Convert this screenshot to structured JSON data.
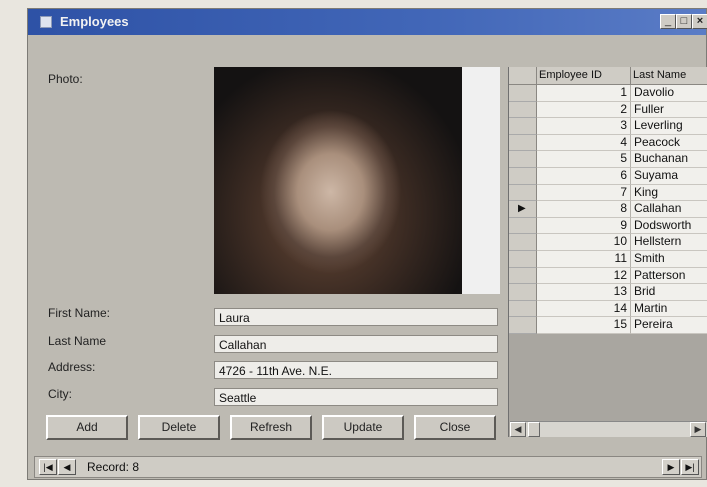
{
  "window": {
    "title": "Employees"
  },
  "labels": {
    "photo": "Photo:",
    "first_name": "First Name:",
    "last_name": "Last Name",
    "address": "Address:",
    "city": "City:"
  },
  "fields": {
    "first_name": "Laura",
    "last_name": "Callahan",
    "address": "4726 - 11th Ave. N.E.",
    "city": "Seattle"
  },
  "buttons": {
    "add": "Add",
    "delete": "Delete",
    "refresh": "Refresh",
    "update": "Update",
    "close": "Close"
  },
  "grid": {
    "columns": [
      "Employee ID",
      "Last Name"
    ],
    "selected_row": 7,
    "rows": [
      {
        "id": "1",
        "last_name": "Davolio"
      },
      {
        "id": "2",
        "last_name": "Fuller"
      },
      {
        "id": "3",
        "last_name": "Leverling"
      },
      {
        "id": "4",
        "last_name": "Peacock"
      },
      {
        "id": "5",
        "last_name": "Buchanan"
      },
      {
        "id": "6",
        "last_name": "Suyama"
      },
      {
        "id": "7",
        "last_name": "King"
      },
      {
        "id": "8",
        "last_name": "Callahan"
      },
      {
        "id": "9",
        "last_name": "Dodsworth"
      },
      {
        "id": "10",
        "last_name": "Hellstern"
      },
      {
        "id": "11",
        "last_name": "Smith"
      },
      {
        "id": "12",
        "last_name": "Patterson"
      },
      {
        "id": "13",
        "last_name": "Brid"
      },
      {
        "id": "14",
        "last_name": "Martin"
      },
      {
        "id": "15",
        "last_name": "Pereira"
      }
    ]
  },
  "navigator": {
    "caption": "Record: 8"
  },
  "icons": {
    "app": "form-icon",
    "minimize": "minimize-icon",
    "maximize": "maximize-icon",
    "close": "close-icon",
    "first": "first-record-icon",
    "prev": "previous-record-icon",
    "next": "next-record-icon",
    "last": "last-record-icon",
    "row_pointer": "current-row-arrow-icon"
  },
  "colors": {
    "titlebar": "#2e52a6",
    "window": "#bdbab2"
  }
}
